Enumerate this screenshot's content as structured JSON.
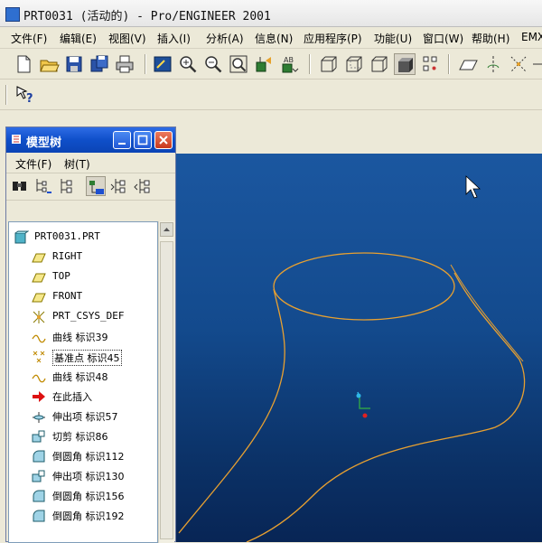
{
  "window": {
    "title": "PRT0031 (活动的) - Pro/ENGINEER 2001"
  },
  "menu": [
    {
      "label": "文件(F)"
    },
    {
      "label": "编辑(E)"
    },
    {
      "label": "视图(V)"
    },
    {
      "label": "插入(I)"
    },
    {
      "label": "分析(A)"
    },
    {
      "label": "信息(N)"
    },
    {
      "label": "应用程序(P)"
    },
    {
      "label": "功能(U)"
    },
    {
      "label": "窗口(W)"
    },
    {
      "label": "帮助(H)"
    },
    {
      "label": "EMX"
    }
  ],
  "toolbar": {
    "icons": [
      "new-icon",
      "open-icon",
      "save-icon",
      "save-copy-icon",
      "print-icon",
      "repaint-icon",
      "zoom-in-icon",
      "zoom-out-icon",
      "refit-icon",
      "orient-icon",
      "named-views-icon",
      "wireframe-icon",
      "hidden-line-icon",
      "no-hidden-icon",
      "shading-icon",
      "spin-center-icon",
      "datum-planes-icon",
      "datum-axes-icon",
      "csys-icon"
    ]
  },
  "toolbar2": {
    "icons": [
      "whats-this-icon"
    ]
  },
  "model_tree": {
    "title": "模型树",
    "menu": [
      {
        "label": "文件(F)"
      },
      {
        "label": "树(T)"
      }
    ],
    "items": [
      {
        "label": "PRT0031.PRT",
        "icon": "part-icon"
      },
      {
        "label": "RIGHT",
        "icon": "datum-plane-icon"
      },
      {
        "label": "TOP",
        "icon": "datum-plane-icon"
      },
      {
        "label": "FRONT",
        "icon": "datum-plane-icon"
      },
      {
        "label": "PRT_CSYS_DEF",
        "icon": "csys-icon"
      },
      {
        "label": "曲线 标识39",
        "icon": "curve-icon"
      },
      {
        "label": "基准点 标识45",
        "icon": "datum-point-icon"
      },
      {
        "label": "曲线 标识48",
        "icon": "curve-icon"
      },
      {
        "label": "在此插入",
        "icon": "insert-here-icon"
      },
      {
        "label": "伸出项 标识57",
        "icon": "protrusion-icon"
      },
      {
        "label": "切剪 标识86",
        "icon": "cut-icon"
      },
      {
        "label": "倒圆角 标识112",
        "icon": "round-icon"
      },
      {
        "label": "伸出项 标识130",
        "icon": "protrusion-icon"
      },
      {
        "label": "倒圆角 标识156",
        "icon": "round-icon"
      },
      {
        "label": "倒圆角 标识192",
        "icon": "round-icon"
      }
    ]
  },
  "colors": {
    "viewport_top": "#1b57a0",
    "viewport_bottom": "#082555",
    "geometry": "#e8a030",
    "title_blue": "#0f4fc9"
  }
}
